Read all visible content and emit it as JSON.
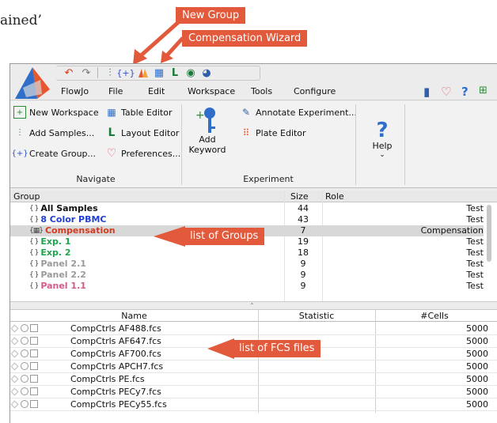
{
  "page_fragment": "ained’",
  "callouts": {
    "new_group": "New Group",
    "compensation_wizard": "Compensation Wizard",
    "list_of_groups": "list of Groups",
    "list_of_fcs": "list of FCS files"
  },
  "menu": {
    "tabs": [
      "FlowJo",
      "File",
      "Edit",
      "Workspace",
      "Tools",
      "Configure"
    ]
  },
  "ribbon": {
    "navigate": {
      "label": "Navigate",
      "buttons": [
        "New Workspace",
        "Add Samples...",
        "Create Group...",
        "Table Editor",
        "Layout Editor",
        "Preferences..."
      ]
    },
    "experiment": {
      "label": "Experiment",
      "add_keyword": "Add\nKeyword",
      "add_keyword_line1": "Add",
      "add_keyword_line2": "Keyword",
      "annotate": "Annotate Experiment...",
      "plate_editor": "Plate Editor"
    },
    "help": {
      "label": "Help"
    }
  },
  "groups": {
    "headers": {
      "group": "Group",
      "size": "Size",
      "role": "Role"
    },
    "rows": [
      {
        "name": "All Samples",
        "size": "44",
        "role": "Test",
        "color": "#111111",
        "icon": "{ }"
      },
      {
        "name": "8 Color PBMC",
        "size": "43",
        "role": "Test",
        "color": "#1f3fd1",
        "icon": "{ }"
      },
      {
        "name": "Compensation",
        "size": "7",
        "role": "Compensation",
        "color": "#d33a20",
        "icon": "{▦}"
      },
      {
        "name": "Exp. 1",
        "size": "19",
        "role": "Test",
        "color": "#1aa64a",
        "icon": "{ }"
      },
      {
        "name": "Exp. 2",
        "size": "18",
        "role": "Test",
        "color": "#1aa64a",
        "icon": "{ }"
      },
      {
        "name": "Panel 2.1",
        "size": "9",
        "role": "Test",
        "color": "#9a9a9a",
        "icon": "{ }"
      },
      {
        "name": "Panel 2.2",
        "size": "9",
        "role": "Test",
        "color": "#9a9a9a",
        "icon": "{ }"
      },
      {
        "name": "Panel 1.1",
        "size": "9",
        "role": "Test",
        "color": "#d35a8a",
        "icon": "{ }"
      }
    ]
  },
  "samples": {
    "headers": {
      "name": "Name",
      "statistic": "Statistic",
      "cells": "#Cells"
    },
    "rows": [
      {
        "name": "CompCtrls AF488.fcs",
        "cells": "5000"
      },
      {
        "name": "CompCtrls AF647.fcs",
        "cells": "5000"
      },
      {
        "name": "CompCtrls AF700.fcs",
        "cells": "5000"
      },
      {
        "name": "CompCtrls APCH7.fcs",
        "cells": "5000"
      },
      {
        "name": "CompCtrls PE.fcs",
        "cells": "5000"
      },
      {
        "name": "CompCtrls PECy7.fcs",
        "cells": "5000"
      },
      {
        "name": "CompCtrls PECy55.fcs",
        "cells": "5000"
      }
    ]
  },
  "colors": {
    "callout": "#e2593b",
    "selected_row": "#d8d8d8"
  }
}
